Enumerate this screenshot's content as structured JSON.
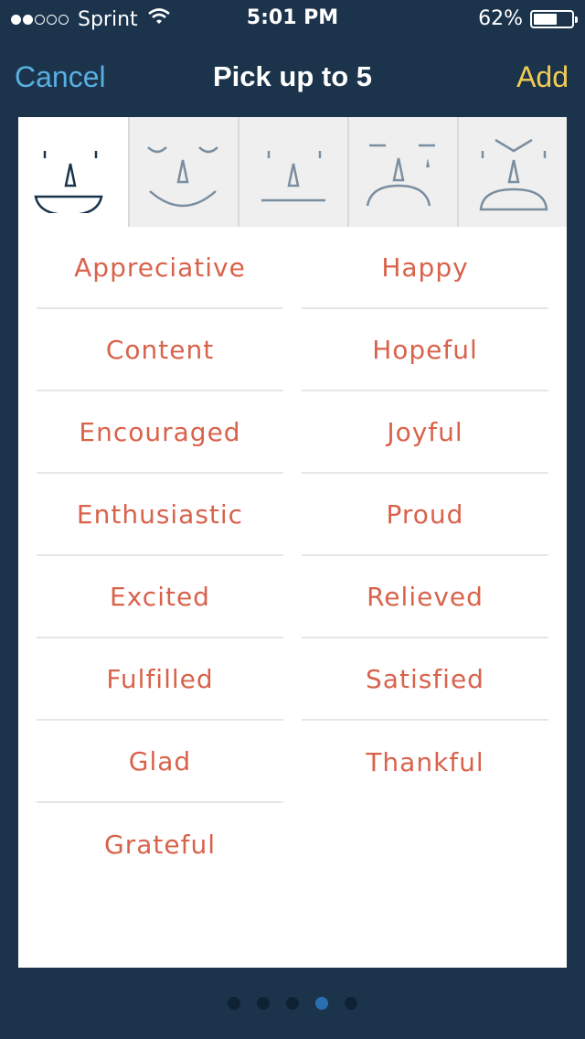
{
  "status": {
    "carrier": "Sprint",
    "time": "5:01 PM",
    "battery_text": "62%",
    "battery_level": 0.62
  },
  "nav": {
    "cancel_label": "Cancel",
    "title": "Pick up to 5",
    "add_label": "Add"
  },
  "tabs": [
    {
      "icon": "very-happy-face-icon",
      "active": true
    },
    {
      "icon": "content-face-icon",
      "active": false
    },
    {
      "icon": "neutral-face-icon",
      "active": false
    },
    {
      "icon": "sad-face-icon",
      "active": false
    },
    {
      "icon": "angry-face-icon",
      "active": false
    }
  ],
  "moods": {
    "left": [
      "Appreciative",
      "Content",
      "Encouraged",
      "Enthusiastic",
      "Excited",
      "Fulfilled",
      "Glad",
      "Grateful"
    ],
    "right": [
      "Happy",
      "Hopeful",
      "Joyful",
      "Proud",
      "Relieved",
      "Satisfied",
      "Thankful"
    ]
  },
  "pager": {
    "count": 5,
    "active_index": 3
  },
  "colors": {
    "background": "#1b344c",
    "cancel": "#5aaee0",
    "add": "#f2cc52",
    "mood_text": "#d9624b",
    "active_face": "#1b344c",
    "inactive_face": "#7a8ea0"
  }
}
